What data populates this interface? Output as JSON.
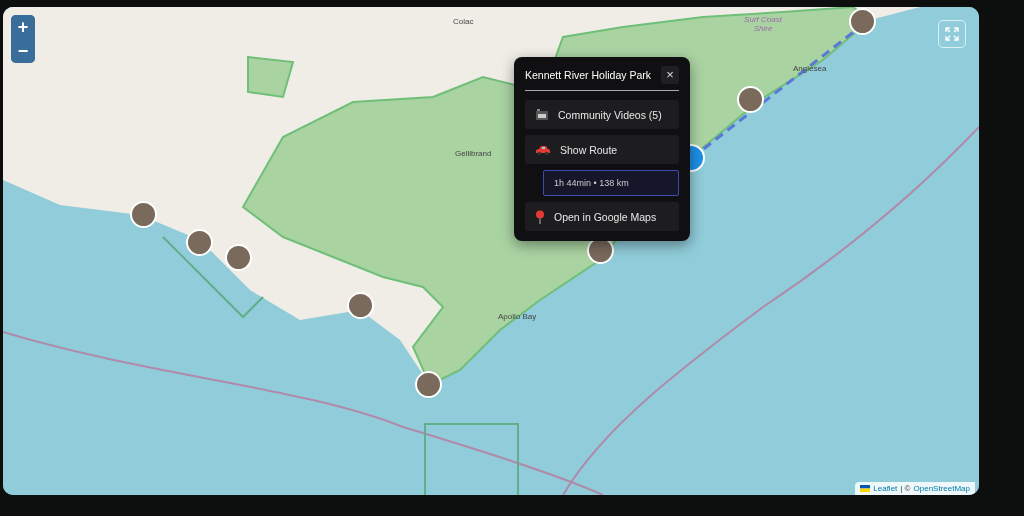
{
  "zoom_control": {
    "zoom_in": "+",
    "zoom_out": "−"
  },
  "map_labels": [
    {
      "text": "Colac",
      "kind": "town"
    },
    {
      "text": "Gellibrand",
      "kind": "town"
    },
    {
      "text": "Apollo Bay",
      "kind": "town"
    },
    {
      "text": "Anglesea",
      "kind": "town"
    },
    {
      "text": "Surf Coast Shire",
      "kind": "region"
    }
  ],
  "popup": {
    "title": "Kennett River Holiday Park",
    "close": "×",
    "actions": [
      {
        "kind": "video",
        "label": "Community Videos (5)"
      },
      {
        "kind": "car",
        "label": "Show Route"
      },
      {
        "kind": "pin",
        "label": "Open in Google Maps"
      }
    ],
    "route_info": "1h 44min • 138 km"
  },
  "attribution": {
    "leaflet": "Leaflet",
    "separator": "| ©",
    "osm": "OpenStreetMap"
  }
}
